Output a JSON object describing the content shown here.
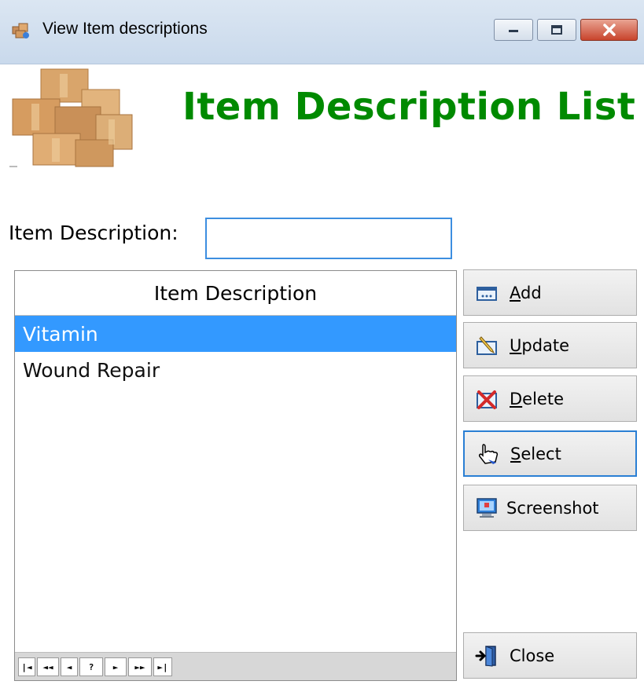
{
  "window": {
    "title": "View Item descriptions",
    "icon": "app-boxes-icon",
    "controls": [
      "minimize-icon",
      "maximize-icon",
      "close-icon"
    ]
  },
  "header": {
    "title": "Item Description List",
    "logo": "cardboard-boxes-icon",
    "title_color": "#008a00"
  },
  "search": {
    "label": "Item Description:",
    "value": "",
    "placeholder": ""
  },
  "grid": {
    "column_header": "Item Description",
    "rows": [
      "Vitamin",
      "Wound Repair"
    ],
    "selected_index": 0,
    "selection_color": "#3399ff",
    "navigator": [
      "|◄",
      "◄◄",
      "◄",
      "?",
      "►",
      "►►",
      "►|"
    ]
  },
  "buttons": {
    "add": {
      "mnemonic": "A",
      "rest": "dd",
      "icon": "add-icon"
    },
    "update": {
      "mnemonic": "U",
      "rest": "pdate",
      "icon": "edit-icon"
    },
    "delete": {
      "mnemonic": "D",
      "rest": "elete",
      "icon": "delete-icon"
    },
    "select": {
      "mnemonic": "S",
      "rest": "elect",
      "icon": "hand-pointer-icon"
    },
    "screenshot": {
      "label": "Screenshot",
      "icon": "monitor-icon"
    },
    "close": {
      "label": "Close",
      "icon": "exit-door-icon"
    }
  }
}
